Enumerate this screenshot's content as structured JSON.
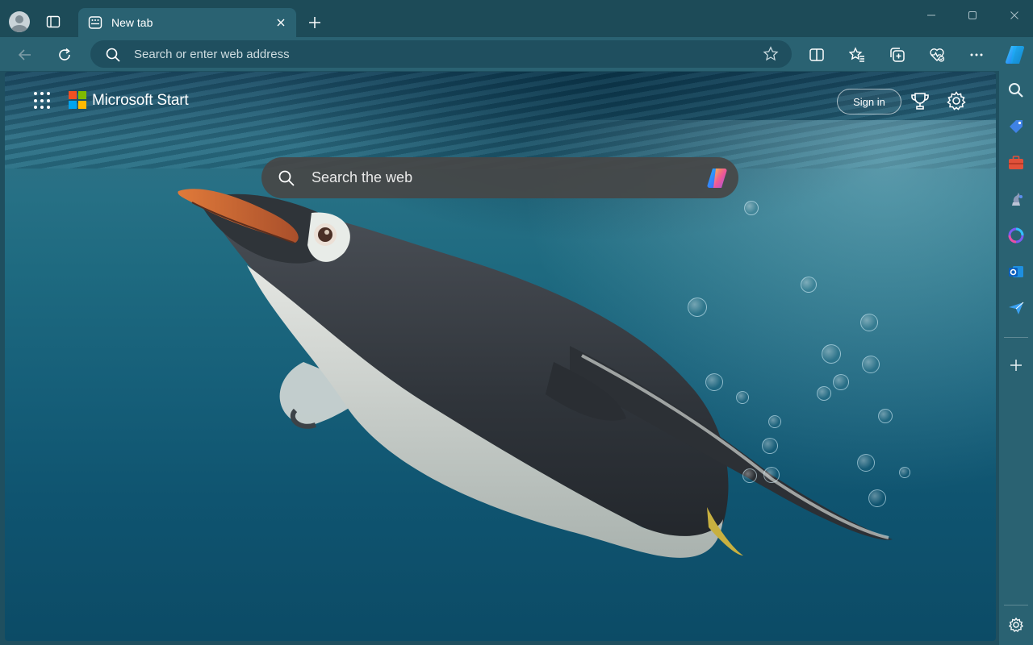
{
  "tab": {
    "title": "New tab"
  },
  "addressbar": {
    "placeholder": "Search or enter web address"
  },
  "page": {
    "brand": "Microsoft Start",
    "signin_label": "Sign in",
    "search_placeholder": "Search the web"
  },
  "icons": {
    "profile": "profile-avatar-icon",
    "tab_actions": "tab-actions-icon",
    "newtab_favicon": "newtab-favicon-icon",
    "close": "close-icon",
    "plus": "plus-icon",
    "back": "back-arrow-icon",
    "refresh": "refresh-icon",
    "search": "search-icon",
    "favorite": "star-icon",
    "split_screen": "split-screen-icon",
    "favorites": "favorites-icon",
    "collections": "collections-icon",
    "browser_essentials": "heart-pulse-icon",
    "more": "more-icon",
    "copilot": "copilot-icon",
    "apps": "app-launcher-icon",
    "rewards": "trophy-icon",
    "settings": "gear-icon"
  },
  "colors": {
    "titlebar": "#1d4b58",
    "toolbar": "#2a6272",
    "addressbar": "#1f4f5f",
    "searchbox": "#464646"
  }
}
